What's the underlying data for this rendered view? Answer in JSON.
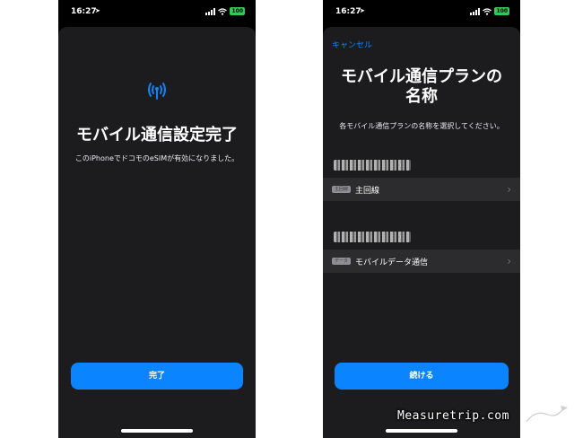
{
  "left": {
    "status": {
      "time": "16:27",
      "battery": "100"
    },
    "title": "モバイル通信設定完了",
    "subtitle": "このiPhoneでドコモのeSIMが有効になりました。",
    "done_button": "完了",
    "icon": "antenna-icon"
  },
  "right": {
    "status": {
      "time": "16:27",
      "battery": "100"
    },
    "cancel": "キャンセル",
    "title_line1": "モバイル通信プランの",
    "title_line2": "名称",
    "subtitle": "各モバイル通信プランの名称を選択してください。",
    "plans": [
      {
        "badge": "主回線",
        "label": "主回線"
      },
      {
        "badge": "データ",
        "label": "モバイルデータ通信"
      }
    ],
    "continue_button": "続ける"
  },
  "watermark": "Measuretrip.com",
  "colors": {
    "accent": "#0a84ff",
    "sheet": "#1c1c1e",
    "row": "#2c2c2e",
    "battery": "#34c759"
  }
}
